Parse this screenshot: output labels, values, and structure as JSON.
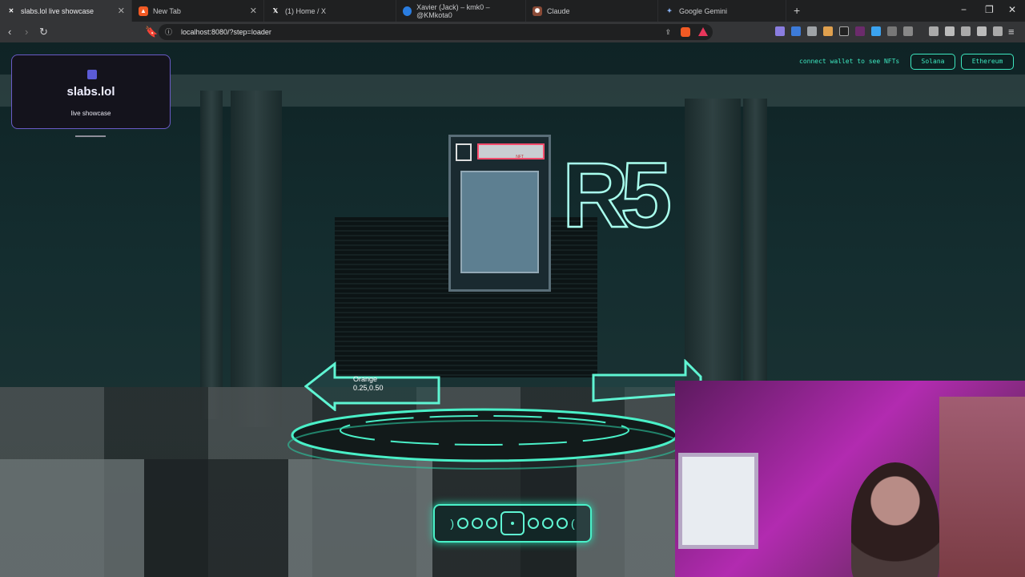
{
  "browser": {
    "tabs": [
      {
        "title": "slabs.lol live showcase",
        "active": true,
        "icon": "slabs-favicon"
      },
      {
        "title": "New Tab",
        "active": false,
        "icon": "brave-icon"
      },
      {
        "title": "(1) Home / X",
        "active": false,
        "icon": "x-icon"
      },
      {
        "title": "Xavier (Jack) – kmk0 – @KMkota0",
        "active": false,
        "icon": "globe-icon"
      },
      {
        "title": "Claude",
        "active": false,
        "icon": "claude-icon"
      },
      {
        "title": "Google Gemini",
        "active": false,
        "icon": "gemini-icon"
      }
    ],
    "url": "localhost:8080/?step=loader"
  },
  "hud": {
    "title": "slabs.lol",
    "subtitle": "live showcase"
  },
  "wallet": {
    "prompt": "connect wallet to see NFTs",
    "buttons": [
      "Solana",
      "Ethereum"
    ]
  },
  "item": {
    "name": "Orange",
    "coords": "0.25,0.50"
  },
  "slab": {
    "label": "NFT",
    "sign": "R5"
  },
  "pager": {
    "count": 7,
    "selected_index": 3
  }
}
